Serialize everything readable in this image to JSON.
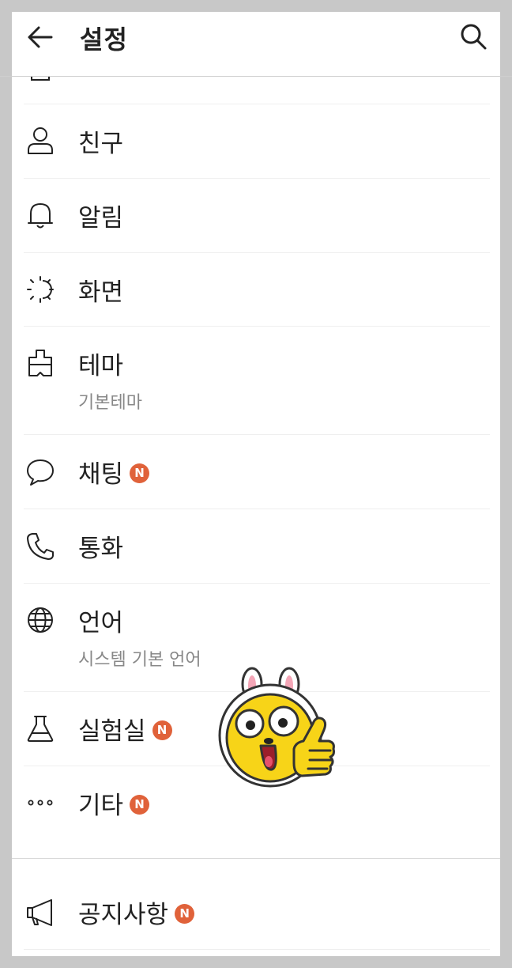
{
  "header": {
    "title": "설정",
    "back_icon": "arrow-left-icon",
    "search_icon": "search-icon"
  },
  "menu": [
    {
      "label": "친구",
      "icon": "person-icon",
      "badge": ""
    },
    {
      "label": "알림",
      "icon": "bell-icon",
      "badge": ""
    },
    {
      "label": "화면",
      "icon": "brightness-icon",
      "badge": ""
    },
    {
      "label": "테마",
      "icon": "paint-brush-icon",
      "sub": "기본테마",
      "badge": ""
    },
    {
      "label": "채팅",
      "icon": "chat-bubble-icon",
      "badge": "N"
    },
    {
      "label": "통화",
      "icon": "phone-icon",
      "badge": ""
    },
    {
      "label": "언어",
      "icon": "globe-icon",
      "sub": "시스템 기본 언어",
      "badge": ""
    },
    {
      "label": "실험실",
      "icon": "flask-icon",
      "badge": "N"
    },
    {
      "label": "기타",
      "icon": "more-dots-icon",
      "badge": "N"
    }
  ],
  "notice": {
    "label": "공지사항",
    "icon": "megaphone-icon",
    "badge": "N"
  },
  "sticker": "rabbit-ear-character-thumbs-up-sticker",
  "colors": {
    "badge": "#e0623a",
    "text": "#222222",
    "subtext": "#888888",
    "sticker_yellow": "#f7d418"
  }
}
